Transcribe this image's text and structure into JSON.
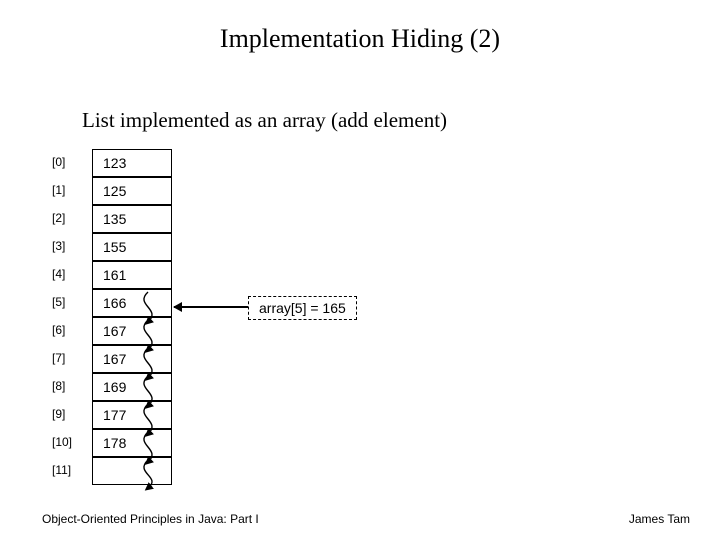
{
  "title": "Implementation Hiding (2)",
  "subtitle": "List implemented as an array (add element)",
  "array": {
    "indices": [
      "[0]",
      "[1]",
      "[2]",
      "[3]",
      "[4]",
      "[5]",
      "[6]",
      "[7]",
      "[8]",
      "[9]",
      "[10]",
      "[11]"
    ],
    "values": [
      "123",
      "125",
      "135",
      "155",
      "161",
      "166",
      "167",
      "167",
      "169",
      "177",
      "178",
      ""
    ]
  },
  "annotation": "array[5] = 165",
  "footer_left": "Object-Oriented Principles in Java: Part I",
  "footer_right": "James Tam"
}
